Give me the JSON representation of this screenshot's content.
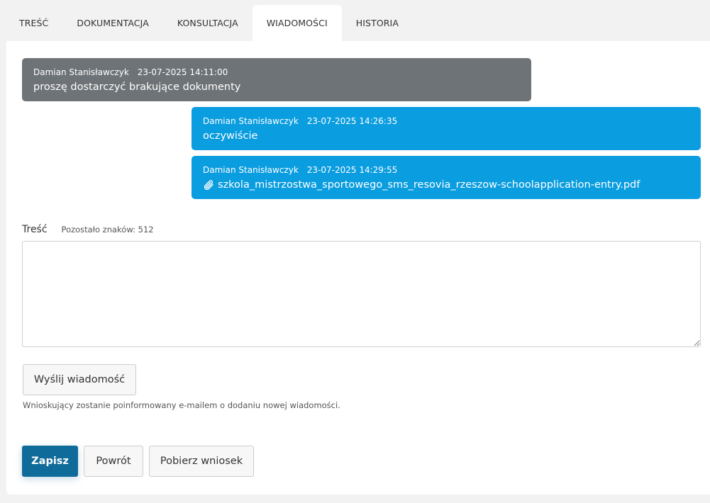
{
  "tabs": [
    {
      "label": "TREŚĆ"
    },
    {
      "label": "DOKUMENTACJA"
    },
    {
      "label": "KONSULTACJA"
    },
    {
      "label": "WIADOMOŚCI",
      "active": true
    },
    {
      "label": "HISTORIA"
    }
  ],
  "messages": [
    {
      "author": "Damian Stanisławczyk",
      "time": "23-07-2025 14:11:00",
      "text": "proszę dostarczyć brakujące dokumenty",
      "style": "gray"
    },
    {
      "author": "Damian Stanisławczyk",
      "time": "23-07-2025 14:26:35",
      "text": "oczywiście",
      "style": "blue"
    },
    {
      "author": "Damian Stanisławczyk",
      "time": "23-07-2025 14:29:55",
      "attachment": "szkola_mistrzostwa_sportowego_sms_resovia_rzeszow-schoolapplication-entry.pdf",
      "style": "blue",
      "icon": "paperclip-icon"
    }
  ],
  "form": {
    "label": "Treść",
    "remaining": "Pozostało znaków: 512",
    "value": "",
    "send_label": "Wyślij wiadomość",
    "note": "Wnioskujący zostanie poinformowany e-mailem o dodaniu nowej wiadomości."
  },
  "actions": {
    "save_label": "Zapisz",
    "back_label": "Powrót",
    "download_label": "Pobierz wniosek"
  },
  "colors": {
    "gray_message": "#6e7377",
    "blue_message": "#0a9de0",
    "primary": "#0f6b9a"
  }
}
